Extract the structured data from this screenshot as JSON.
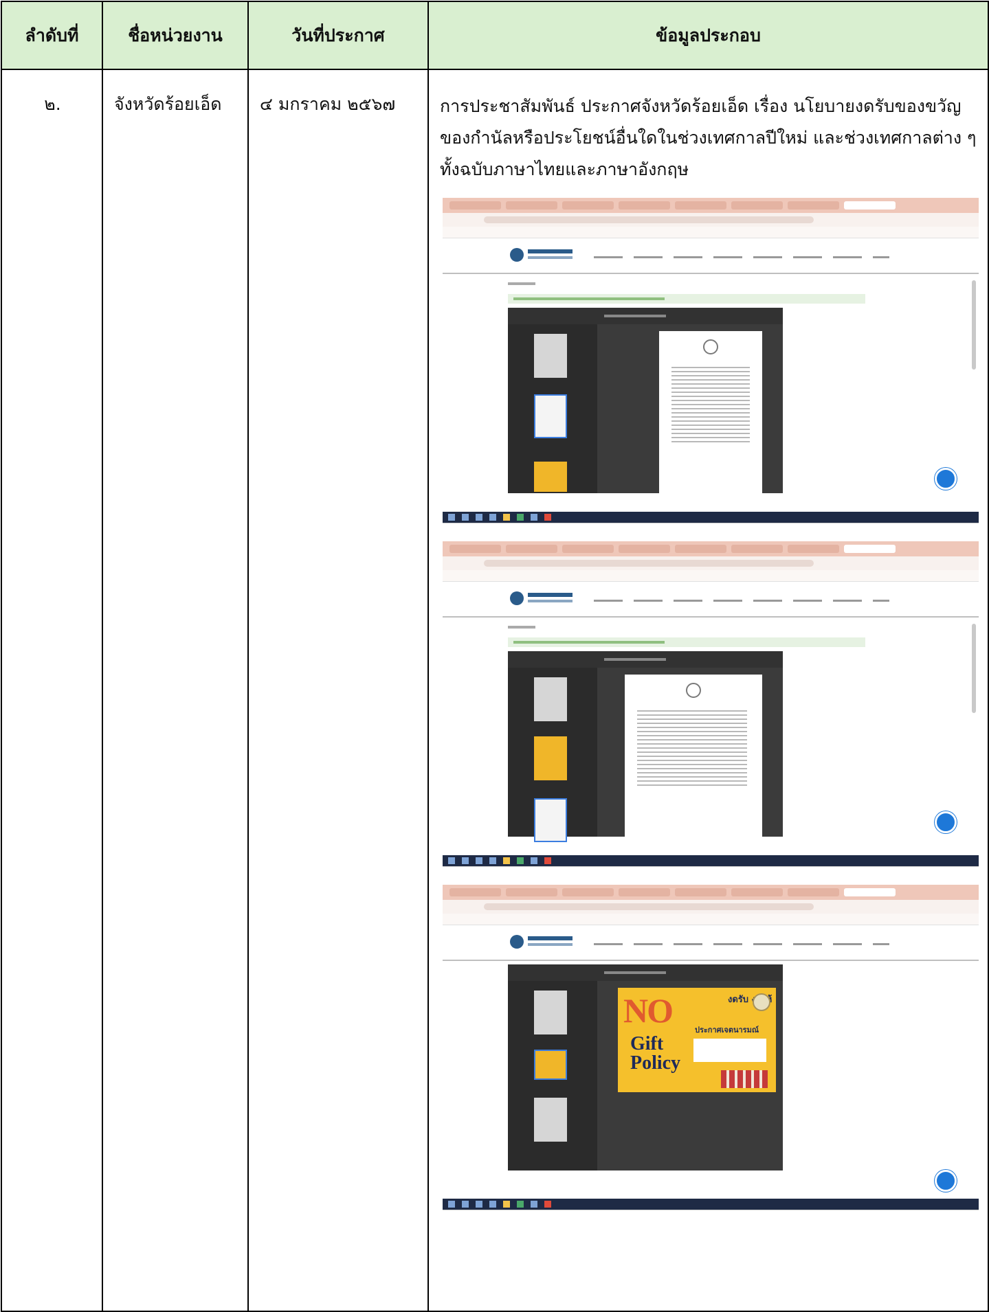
{
  "table": {
    "headers": [
      "ลำดับที่",
      "ชื่อหน่วยงาน",
      "วันที่ประกาศ",
      "ข้อมูลประกอบ"
    ],
    "row": {
      "no": "๒.",
      "agency": "จังหวัดร้อยเอ็ด",
      "date": "๔ มกราคม ๒๕๖๗",
      "description": "การประชาสัมพันธ์ ประกาศจังหวัดร้อยเอ็ด เรื่อง นโยบายงดรับของขวัญของกำนัลหรือประโยชน์อื่นใดในช่วงเทศกาลปีใหม่ และช่วงเทศกาลต่าง ๆ ทั้งฉบับภาษาไทยและภาษาอังกฤษ"
    }
  },
  "screenshots": {
    "site_name": "จังหวัดร้อยเอ็ด",
    "poster": {
      "no": "NO",
      "gift": "Gift",
      "policy": "Policy",
      "thai_top": "งดรับ งดให้",
      "thai_sub": "ประกาศเจตนารมณ์"
    }
  }
}
